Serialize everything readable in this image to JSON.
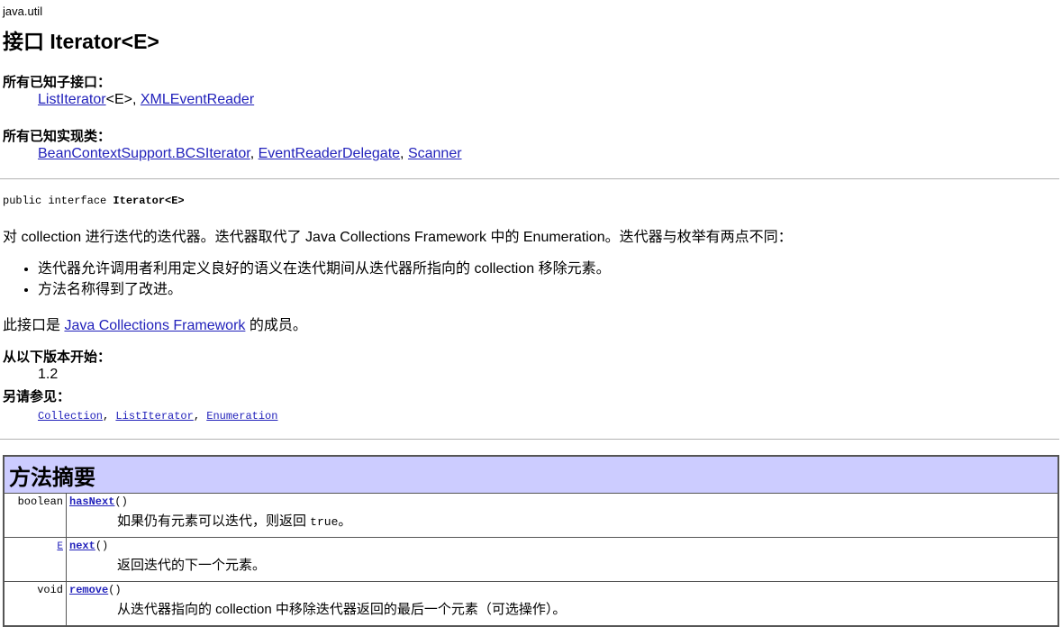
{
  "package": "java.util",
  "title": "接口 Iterator<E>",
  "subinterfaces": {
    "label": "所有已知子接口：",
    "link1": "ListIterator",
    "link1_suffix": "<E>,",
    "link2": "XMLEventReader"
  },
  "implementing": {
    "label": "所有已知实现类：",
    "links": [
      "BeanContextSupport.BCSIterator",
      "EventReaderDelegate",
      "Scanner"
    ],
    "sep": ","
  },
  "signature": {
    "prefix": "public interface ",
    "name": "Iterator<E>"
  },
  "description": "对 collection 进行迭代的迭代器。迭代器取代了 Java Collections Framework 中的 Enumeration。迭代器与枚举有两点不同：",
  "bullets": [
    "迭代器允许调用者利用定义良好的语义在迭代期间从迭代器所指向的 collection 移除元素。",
    "方法名称得到了改进。"
  ],
  "member": {
    "prefix": "此接口是 ",
    "link": "Java Collections Framework",
    "suffix": " 的成员。"
  },
  "since": {
    "label": "从以下版本开始：",
    "value": "1.2"
  },
  "see_also": {
    "label": "另请参见：",
    "links": [
      "Collection",
      "ListIterator",
      "Enumeration"
    ],
    "sep": ","
  },
  "method_summary": {
    "header": "方法摘要",
    "rows": [
      {
        "type": "boolean",
        "type_is_link": false,
        "name": "hasNext",
        "params": "()",
        "desc_pre": "如果仍有元素可以迭代，则返回 ",
        "desc_code": "true",
        "desc_post": "。"
      },
      {
        "type": "E",
        "type_is_link": true,
        "name": "next",
        "params": "()",
        "desc_pre": "返回迭代的下一个元素。",
        "desc_code": "",
        "desc_post": ""
      },
      {
        "type": "void",
        "type_is_link": false,
        "name": "remove",
        "params": "()",
        "desc_pre": "从迭代器指向的 collection 中移除迭代器返回的最后一个元素（可选操作）。",
        "desc_code": "",
        "desc_post": ""
      }
    ]
  }
}
